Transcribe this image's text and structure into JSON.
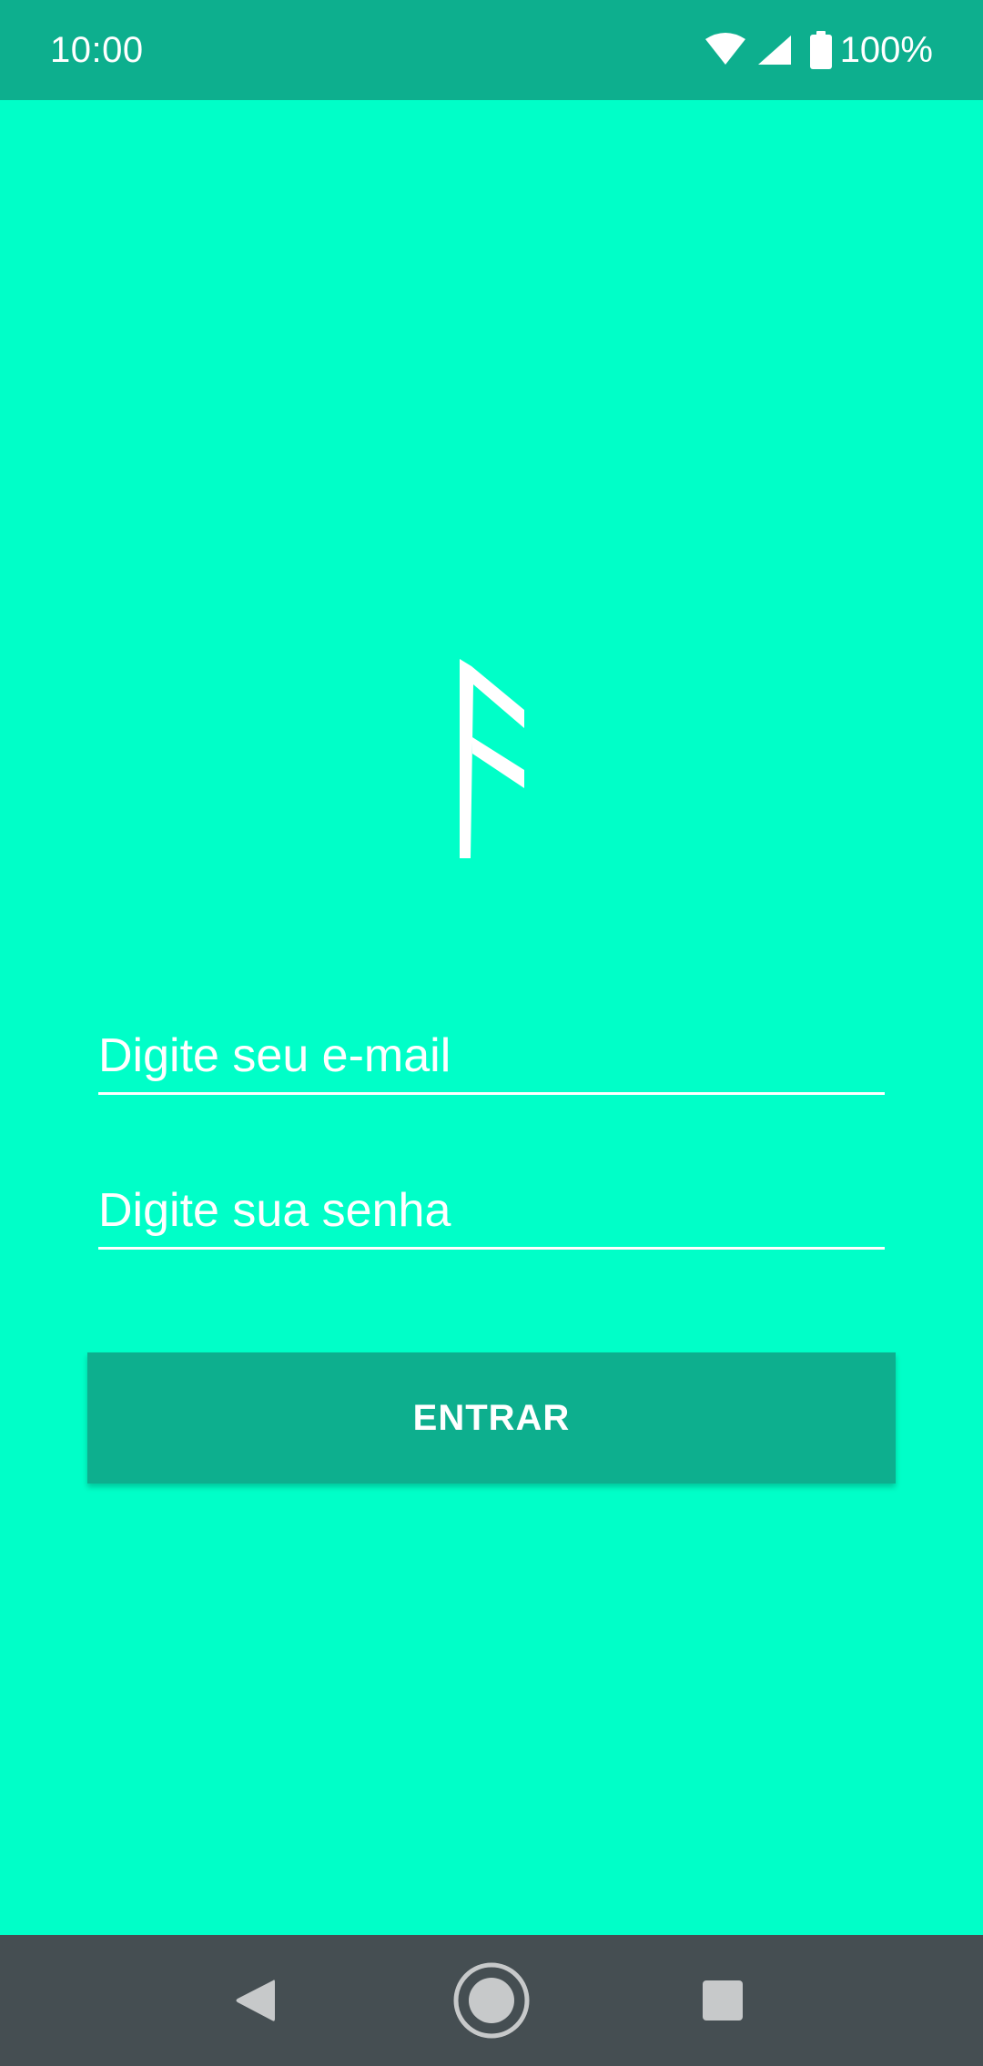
{
  "status_bar": {
    "time": "10:00",
    "battery_text": "100%",
    "icons": [
      "wifi-icon",
      "cellular-signal-icon",
      "battery-icon"
    ]
  },
  "logo": {
    "icon": "rune-logo-icon"
  },
  "form": {
    "email_placeholder": "Digite seu e-mail",
    "password_placeholder": "Digite sua senha",
    "login_label": "ENTRAR"
  },
  "nav_bar": {
    "icons": [
      "back-icon",
      "home-icon",
      "recents-icon"
    ]
  },
  "colors": {
    "background": "#00FFC8",
    "accent": "#0DAF8E",
    "nav_bar": "#454E52",
    "text": "#FFFFFF"
  }
}
